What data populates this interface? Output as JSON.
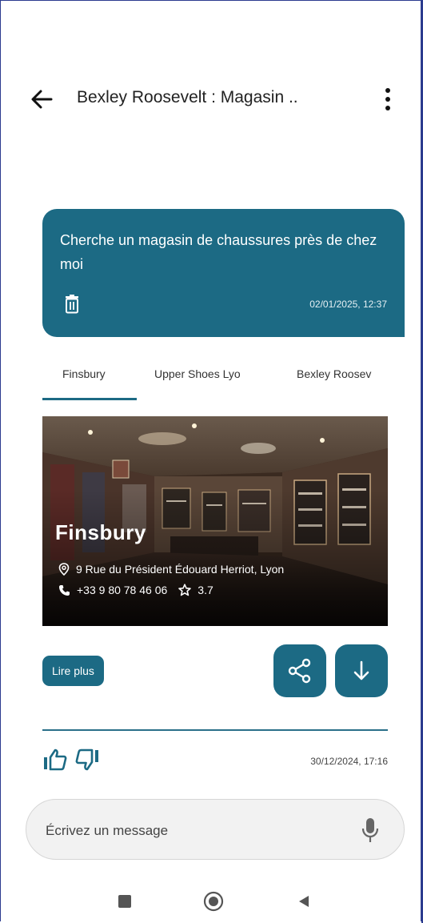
{
  "header": {
    "title": "Bexley Roosevelt : Magasin ..",
    "back_icon": "arrow-left-icon",
    "more_icon": "more-vertical-icon"
  },
  "query": {
    "text": "Cherche un magasin de chaussures près de chez moi",
    "timestamp": "02/01/2025, 12:37",
    "delete_icon": "trash-icon"
  },
  "tabs": [
    {
      "label": "Finsbury",
      "selected": true
    },
    {
      "label": "Upper Shoes Lyo"
    },
    {
      "label": "Bexley Roosev"
    }
  ],
  "store": {
    "name": "Finsbury",
    "address": "9 Rue du Président Édouard Herriot, Lyon",
    "phone": "+33 9 80 78 46 06",
    "rating": "3.7"
  },
  "actions": {
    "read_more_label": "Lire plus",
    "share_icon": "share-icon",
    "download_icon": "arrow-down-icon"
  },
  "feedback": {
    "timestamp": "30/12/2024, 17:16",
    "like_icon": "thumbs-up-icon",
    "dislike_icon": "thumbs-down-icon"
  },
  "composer": {
    "placeholder": "Écrivez un message",
    "mic_icon": "microphone-icon"
  },
  "colors": {
    "accent": "#1c6a84",
    "background": "#ffffff",
    "input_bg": "#f2f2f2"
  }
}
